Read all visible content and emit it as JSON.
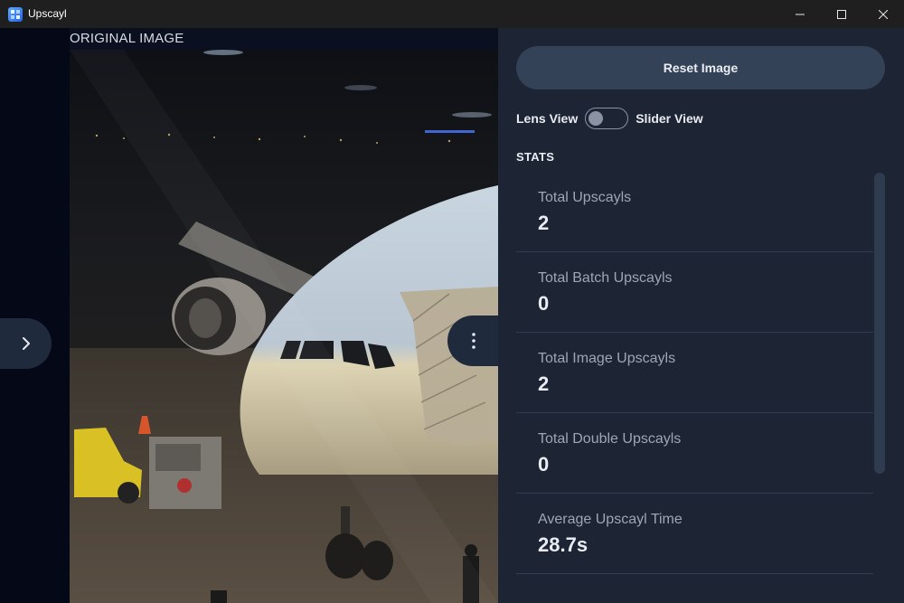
{
  "window": {
    "title": "Upscayl",
    "app_icon": "upscayl-logo-icon",
    "controls": [
      "minimize-icon",
      "maximize-icon",
      "close-icon"
    ]
  },
  "image_view": {
    "label": "ORIGINAL IMAGE",
    "photo_description_icon": "airplane-photo"
  },
  "panel": {
    "reset_button": "Reset Image",
    "lens_view_label": "Lens View",
    "slider_view_label": "Slider View",
    "view_toggle_on": false,
    "stats_heading": "STATS",
    "stats": [
      {
        "label": "Total Upscayls",
        "value": "2"
      },
      {
        "label": "Total Batch Upscayls",
        "value": "0"
      },
      {
        "label": "Total Image Upscayls",
        "value": "2"
      },
      {
        "label": "Total Double Upscayls",
        "value": "0"
      },
      {
        "label": "Average Upscayl Time",
        "value": "28.7s"
      }
    ]
  },
  "colors": {
    "panel_bg": "#1d2433",
    "button_bg": "#334257",
    "left_bg": "#040817"
  }
}
